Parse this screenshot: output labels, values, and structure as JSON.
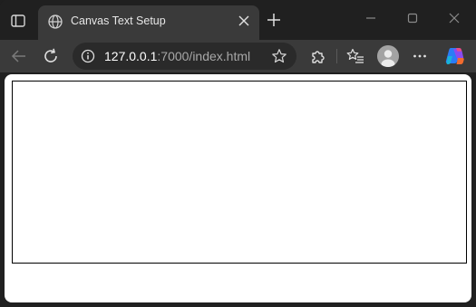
{
  "browser": {
    "tab": {
      "title": "Canvas Text Setup"
    },
    "address_bar": {
      "host": "127.0.0.1",
      "rest": ":7000/index.html"
    }
  },
  "icons": {
    "tab_actions": "tab-actions-icon",
    "favicon": "globe-icon",
    "tab_close": "close-icon",
    "new_tab": "plus-icon",
    "minimize": "minimize-icon",
    "maximize": "maximize-icon",
    "close_window": "close-icon",
    "back": "back-arrow-icon",
    "reload": "reload-icon",
    "site_info": "info-icon",
    "favorite": "star-icon",
    "extensions": "puzzle-icon",
    "favorites": "favorites-icon",
    "profile": "profile-icon",
    "more": "more-icon",
    "copilot": "copilot-icon"
  },
  "colors": {
    "chrome_dark": "#202020",
    "toolbar": "#3a3a3a",
    "content_bg": "#ffffff",
    "canvas_border": "#000000"
  }
}
